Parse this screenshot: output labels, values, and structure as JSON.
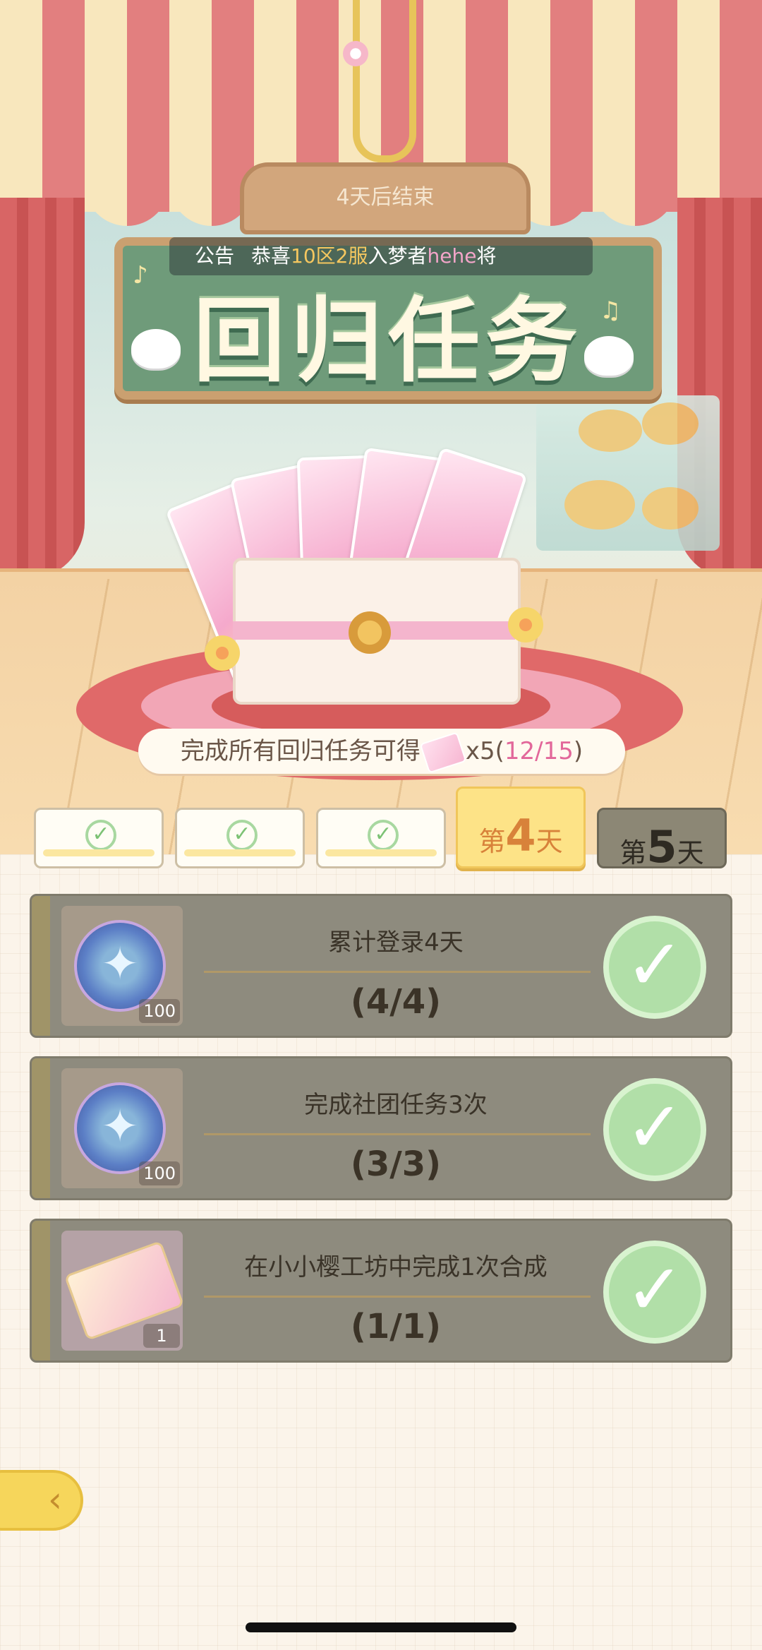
{
  "event": {
    "countdown": "4天后结束",
    "title": "回归任务",
    "announcement": {
      "label": "公告",
      "prefix": "恭喜",
      "server": "10区2服",
      "middle": "入梦者",
      "player": "hehe",
      "suffix": "将"
    },
    "reward_text": "完成所有回归任务可得",
    "reward_multiplier": "x5(",
    "reward_progress": "12/15",
    "reward_close": ")"
  },
  "days": [
    {
      "label": "",
      "status": "done"
    },
    {
      "label": "",
      "status": "done"
    },
    {
      "label": "",
      "status": "done"
    },
    {
      "label_prefix": "第",
      "number": "4",
      "label_suffix": "天",
      "status": "active"
    },
    {
      "label_prefix": "第",
      "number": "5",
      "label_suffix": "天",
      "status": "locked"
    }
  ],
  "tasks": [
    {
      "title": "累计登录4天",
      "progress": "(4/4)",
      "reward_icon": "compass-coin-icon",
      "reward_qty": "100",
      "status": "completed"
    },
    {
      "title": "完成社团任务3次",
      "progress": "(3/3)",
      "reward_icon": "compass-coin-icon",
      "reward_qty": "100",
      "status": "completed"
    },
    {
      "title": "在小小樱工坊中完成1次合成",
      "progress": "(1/1)",
      "reward_icon": "ticket-icon",
      "reward_qty": "1",
      "status": "completed"
    }
  ],
  "colors": {
    "accent_pink": "#e2679a",
    "gold": "#f5c75f",
    "complete_green": "#b1dfa8"
  }
}
